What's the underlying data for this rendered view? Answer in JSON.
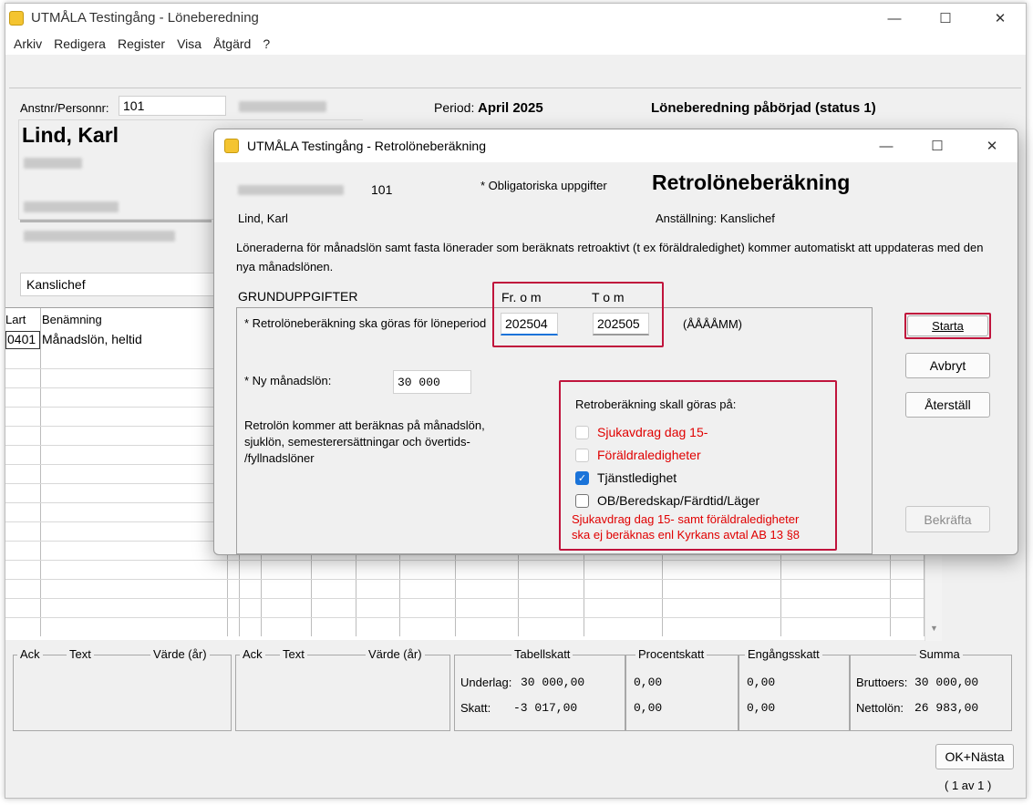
{
  "main_window": {
    "title": "UTMÅLA Testingång - Löneberedning",
    "controls": {
      "minimize": "—",
      "maximize": "☐",
      "close": "✕"
    }
  },
  "menu": {
    "items": [
      "Arkiv",
      "Redigera",
      "Register",
      "Visa",
      "Åtgärd",
      "?"
    ]
  },
  "employee": {
    "id_label": "Anstnr/Personnr:",
    "id_value": "101",
    "name": "Lind, Karl",
    "position_value": "Kanslichef"
  },
  "period": {
    "label": "Period:",
    "value": "April 2025"
  },
  "status_text": "Löneberedning påbörjad (status 1)",
  "grid": {
    "headers": [
      "Lart",
      "Benämning"
    ],
    "rows": [
      {
        "code": "0401",
        "name": "Månadslön, heltid"
      }
    ]
  },
  "summary": {
    "ack1": {
      "ack": "Ack",
      "text": "Text",
      "value": "Värde (år)"
    },
    "ack2": {
      "ack": "Ack",
      "text": "Text",
      "value": "Värde (år)"
    },
    "tabellskatt": {
      "title": "Tabellskatt",
      "underlag_label": "Underlag:",
      "underlag": "30 000,00",
      "skatt_label": "Skatt:",
      "skatt": "-3 017,00"
    },
    "procentskatt": {
      "title": "Procentskatt",
      "underlag": "0,00",
      "skatt": "0,00"
    },
    "engangsskatt": {
      "title": "Engångsskatt",
      "underlag": "0,00",
      "skatt": "0,00"
    },
    "summa": {
      "title": "Summa",
      "brutto_label": "Bruttoers:",
      "brutto": "30 000,00",
      "netto_label": "Nettolön:",
      "netto": "26 983,00"
    }
  },
  "ok_next_button": "OK+Nästa",
  "pager": "( 1 av 1 )",
  "dialog": {
    "title": "UTMÅLA Testingång - Retrolöneberäkning",
    "controls": {
      "minimize": "—",
      "maximize": "☐",
      "close": "✕"
    },
    "emp_number": "101",
    "emp_name": "Lind, Karl",
    "mandatory_note": "* Obligatoriska uppgifter",
    "heading": "Retrolöneberäkning",
    "employment": "Anställning:  Kanslichef",
    "info_line1": "Löneraderna för månadslön samt fasta lönerader som beräknats retroaktivt  (t ex föräldraledighet) kommer automatiskt att uppdateras med den",
    "info_line2": "nya månadslönen.",
    "section_label": "GRUNDUPPGIFTER",
    "from_label": "Fr. o m",
    "to_label": "T o m",
    "period_label": "* Retrolöneberäkning ska göras för löneperiod",
    "from_value": "202504",
    "to_value": "202505",
    "format_hint": "(ÅÅÅÅMM)",
    "new_salary_label": "* Ny månadslön:",
    "new_salary_value": "30 000",
    "retro_info_1": "Retrolön kommer att beräknas på månadslön,",
    "retro_info_2": "sjuklön, semesterersättningar och övertids-",
    "retro_info_3": "/fyllnadslöner",
    "retro_box_title": "Retroberäkning skall göras på:",
    "options": [
      {
        "label": "Sjukavdrag dag 15-",
        "checked": false,
        "disabled": true
      },
      {
        "label": "Föräldraledigheter",
        "checked": false,
        "disabled": true
      },
      {
        "label": "Tjänstledighet",
        "checked": true,
        "disabled": false
      },
      {
        "label": "OB/Beredskap/Färdtid/Läger",
        "checked": false,
        "disabled": false
      }
    ],
    "warning_1": "Sjukavdrag dag 15- samt föräldraledigheter",
    "warning_2": "ska ej beräknas enl Kyrkans avtal AB 13 §8",
    "buttons": {
      "start": "Starta",
      "cancel": "Avbryt",
      "reset": "Återställ",
      "confirm": "Bekräfta"
    }
  },
  "colors": {
    "highlight_red": "#c0143c",
    "warning_text": "#e00000",
    "checkbox_blue": "#1a73d9"
  }
}
